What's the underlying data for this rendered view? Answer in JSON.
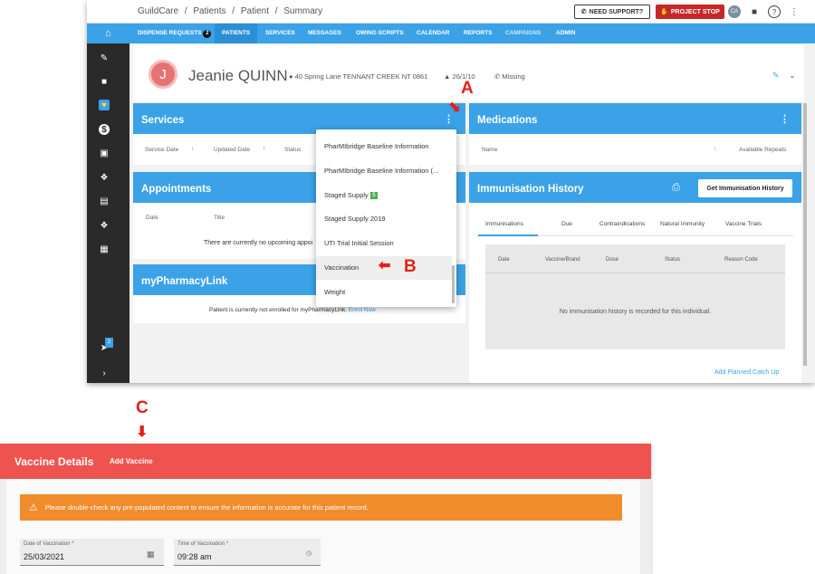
{
  "breadcrumb": [
    "GuildCare",
    "/",
    "Patients",
    "/",
    "Patient",
    "/",
    "Summary"
  ],
  "header": {
    "support": "NEED SUPPORT?",
    "stop": "PROJECT STOP",
    "user_initials": "CA"
  },
  "nav": {
    "dispense": "DISPENSE REQUESTS",
    "dispense_count": "2",
    "patients": "PATIENTS",
    "services": "SERVICES",
    "messages": "MESSAGES",
    "owing": "OWING SCRIPTS",
    "calendar": "CALENDAR",
    "reports": "REPORTS",
    "campaigns": "CAMPAIGNS",
    "admin": "ADMIN"
  },
  "sidebar": {
    "messages_badge": "2"
  },
  "patient": {
    "initial": "J",
    "name": "Jeanie QUINN",
    "address": "40 Spring Lane TENNANT CREEK NT 0861",
    "dob": "26/1/10",
    "phone": "Missing"
  },
  "services": {
    "title": "Services",
    "columns": [
      "Service Date",
      "Updated Date",
      "Status"
    ]
  },
  "appointments": {
    "title": "Appointments",
    "columns": [
      "Date",
      "Title"
    ],
    "empty": "There are currently no upcoming appoi"
  },
  "mypharmacylink": {
    "title": "myPharmacyLink",
    "text": "Patient is currently not enrolled for myPharmacyLink.",
    "link": "Enrol Now"
  },
  "medications": {
    "title": "Medications",
    "columns": [
      "Name",
      "Available Repeats"
    ]
  },
  "immunisation": {
    "title": "Immunisation History",
    "button": "Get Immunisation History",
    "tabs": [
      "Immunisations",
      "Due",
      "Contraindications",
      "Natural Immunity",
      "Vaccine Trials"
    ],
    "columns": [
      "Date",
      "Vaccine/Brand",
      "Dose",
      "Status",
      "Reason Code"
    ],
    "empty": "No immunisation history is recorded for this individual.",
    "catchup": "Add Planned Catch Up"
  },
  "menu": {
    "items": [
      "PharMIbridge Baseline Information",
      "PharMIbridge Baseline Information (...",
      "Staged Supply",
      "Staged Supply 2019",
      "UTI Trial Initial Session",
      "Vaccination",
      "Weight"
    ],
    "staged_badge": "$"
  },
  "annotations": {
    "a": "A",
    "b": "B",
    "c": "C"
  },
  "vaccine": {
    "title": "Vaccine Details",
    "add": "Add Vaccine",
    "warning": "Please double-check any pre-populated content to ensure the information is accurate for this patient record.",
    "date_label": "Date of Vaccination *",
    "date_value": "25/03/2021",
    "time_label": "Time of Vaccination *",
    "time_value": "09:28 am"
  },
  "colors": {
    "nav_blue": "#3ba2e8",
    "sidebar": "#2a2a2a",
    "stop_red": "#c62828",
    "vaccine_red": "#ef5350",
    "warning_orange": "#f08c2c",
    "annotation_red": "#e32119"
  }
}
